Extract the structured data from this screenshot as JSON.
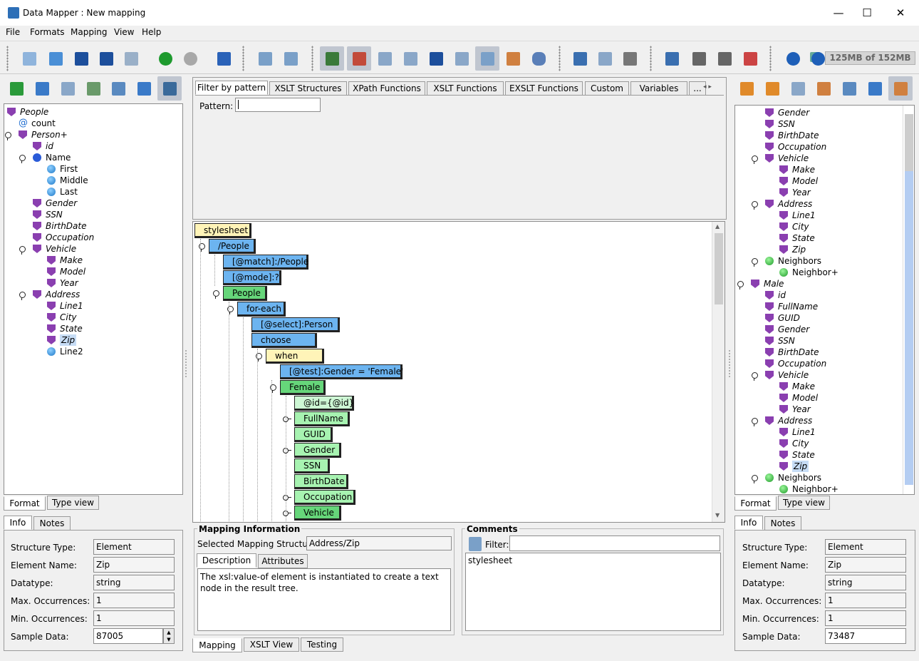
{
  "app": {
    "title": "Data Mapper : New mapping",
    "minimize": "—",
    "maximize": "☐",
    "close": "✕",
    "memory": "125MB of 152MB"
  },
  "menu": [
    "File",
    "Formats",
    "Mapping",
    "View",
    "Help"
  ],
  "colors": {
    "element": "#8a3fb0",
    "node_yellow": "#fff4b8",
    "node_blue": "#6cb4f0",
    "node_green": "#66d67a",
    "node_lightgreen": "#a7f3b1"
  },
  "left_tree": [
    {
      "label": "People",
      "icon": "element-icon",
      "italic": true
    },
    {
      "label": "count",
      "icon": "attribute-icon",
      "italic": false
    },
    {
      "label": "Person+",
      "icon": "element-icon",
      "italic": true
    },
    {
      "label": "id",
      "icon": "key-element-icon",
      "italic": true
    },
    {
      "label": "Name",
      "icon": "blue-circle-icon",
      "italic": false
    },
    {
      "label": "First",
      "icon": "light-blue-circle-icon",
      "italic": false
    },
    {
      "label": "Middle",
      "icon": "light-blue-circle-icon",
      "italic": false
    },
    {
      "label": "Last",
      "icon": "light-blue-circle-icon",
      "italic": false
    },
    {
      "label": "Gender",
      "icon": "element-icon",
      "italic": true
    },
    {
      "label": "SSN",
      "icon": "element-icon",
      "italic": true
    },
    {
      "label": "BirthDate",
      "icon": "element-icon",
      "italic": true
    },
    {
      "label": "Occupation",
      "icon": "element-icon",
      "italic": true
    },
    {
      "label": "Vehicle",
      "icon": "element-icon",
      "italic": true
    },
    {
      "label": "Make",
      "icon": "element-icon",
      "italic": true
    },
    {
      "label": "Model",
      "icon": "element-icon",
      "italic": true
    },
    {
      "label": "Year",
      "icon": "element-icon",
      "italic": true
    },
    {
      "label": "Address",
      "icon": "element-icon",
      "italic": true
    },
    {
      "label": "Line1",
      "icon": "element-icon",
      "italic": true
    },
    {
      "label": "City",
      "icon": "element-icon",
      "italic": true
    },
    {
      "label": "State",
      "icon": "element-icon",
      "italic": true
    },
    {
      "label": "Zip",
      "icon": "element-icon",
      "italic": true
    },
    {
      "label": "Line2",
      "icon": "light-blue-circle-icon",
      "italic": false
    }
  ],
  "right_tree": [
    {
      "label": "Gender",
      "icon": "element-icon",
      "italic": true
    },
    {
      "label": "SSN",
      "icon": "element-icon",
      "italic": true
    },
    {
      "label": "BirthDate",
      "icon": "element-icon",
      "italic": true
    },
    {
      "label": "Occupation",
      "icon": "element-icon",
      "italic": true
    },
    {
      "label": "Vehicle",
      "icon": "element-icon",
      "italic": true
    },
    {
      "label": "Make",
      "icon": "element-icon",
      "italic": true
    },
    {
      "label": "Model",
      "icon": "element-icon",
      "italic": true
    },
    {
      "label": "Year",
      "icon": "element-icon",
      "italic": true
    },
    {
      "label": "Address",
      "icon": "element-icon",
      "italic": true
    },
    {
      "label": "Line1",
      "icon": "element-icon",
      "italic": true
    },
    {
      "label": "City",
      "icon": "element-icon",
      "italic": true
    },
    {
      "label": "State",
      "icon": "element-icon",
      "italic": true
    },
    {
      "label": "Zip",
      "icon": "element-icon",
      "italic": true
    },
    {
      "label": "Neighbors",
      "icon": "green-circle-icon",
      "italic": false
    },
    {
      "label": "Neighbor+",
      "icon": "green-circle-icon",
      "italic": false
    },
    {
      "label": "Male",
      "icon": "element-icon",
      "italic": true
    },
    {
      "label": "id",
      "icon": "key-element-icon",
      "italic": true
    },
    {
      "label": "FullName",
      "icon": "element-icon",
      "italic": true
    },
    {
      "label": "GUID",
      "icon": "element-icon",
      "italic": true
    },
    {
      "label": "Gender",
      "icon": "element-icon",
      "italic": true
    },
    {
      "label": "SSN",
      "icon": "element-icon",
      "italic": true
    },
    {
      "label": "BirthDate",
      "icon": "element-icon",
      "italic": true
    },
    {
      "label": "Occupation",
      "icon": "element-icon",
      "italic": true
    },
    {
      "label": "Vehicle",
      "icon": "element-icon",
      "italic": true
    },
    {
      "label": "Make",
      "icon": "element-icon",
      "italic": true
    },
    {
      "label": "Model",
      "icon": "element-icon",
      "italic": true
    },
    {
      "label": "Year",
      "icon": "element-icon",
      "italic": true
    },
    {
      "label": "Address",
      "icon": "element-icon",
      "italic": true
    },
    {
      "label": "Line1",
      "icon": "element-icon",
      "italic": true
    },
    {
      "label": "City",
      "icon": "element-icon",
      "italic": true
    },
    {
      "label": "State",
      "icon": "element-icon",
      "italic": true
    },
    {
      "label": "Zip",
      "icon": "element-icon",
      "italic": true
    },
    {
      "label": "Neighbors",
      "icon": "green-circle-icon",
      "italic": false
    },
    {
      "label": "Neighbor+",
      "icon": "green-circle-icon",
      "italic": false
    }
  ],
  "left_tabs": {
    "format": "Format",
    "type_view": "Type view",
    "info": "Info",
    "notes": "Notes"
  },
  "info_labels": {
    "structure_type": "Structure Type:",
    "element_name": "Element Name:",
    "datatype": "Datatype:",
    "max": "Max. Occurrences:",
    "min": "Min. Occurrences:",
    "sample": "Sample Data:"
  },
  "left_info": {
    "structure_type": "Element",
    "element_name": "Zip",
    "datatype": "string",
    "max": "1",
    "min": "1",
    "sample": "87005"
  },
  "right_info": {
    "structure_type": "Element",
    "element_name": "Zip",
    "datatype": "string",
    "max": "1",
    "min": "1",
    "sample": "73487"
  },
  "func_tabs": [
    "Filter by pattern",
    "XSLT Structures",
    "XPath Functions",
    "XSLT Functions",
    "EXSLT Functions",
    "Custom",
    "Variables",
    "..."
  ],
  "pattern": {
    "label": "Pattern:",
    "value": ""
  },
  "mapping_nodes": [
    {
      "label": "stylesheet",
      "color": "y"
    },
    {
      "label": "/People",
      "color": "b"
    },
    {
      "label": "[@match]:/People",
      "color": "b"
    },
    {
      "label": "[@mode]:?",
      "color": "b"
    },
    {
      "label": "People",
      "color": "g"
    },
    {
      "label": "for-each",
      "color": "b"
    },
    {
      "label": "[@select]:Person",
      "color": "b"
    },
    {
      "label": "choose",
      "color": "b"
    },
    {
      "label": "when",
      "color": "y"
    },
    {
      "label": "[@test]:Gender = 'Female'",
      "color": "b"
    },
    {
      "label": "Female",
      "color": "g"
    },
    {
      "label": "@id={@id}",
      "color": "w"
    },
    {
      "label": "FullName",
      "color": "lg"
    },
    {
      "label": "GUID",
      "color": "lg"
    },
    {
      "label": "Gender",
      "color": "lg"
    },
    {
      "label": "SSN",
      "color": "lg"
    },
    {
      "label": "BirthDate",
      "color": "lg"
    },
    {
      "label": "Occupation",
      "color": "lg"
    },
    {
      "label": "Vehicle",
      "color": "g"
    }
  ],
  "mapping_info": {
    "title": "Mapping Information",
    "selected_label": "Selected Mapping Structure:",
    "selected_value": "Address/Zip",
    "tab_description": "Description",
    "tab_attributes": "Attributes",
    "description": "The xsl:value-of element is instantiated to create a text node in the result tree."
  },
  "comments": {
    "title": "Comments",
    "filter_label": "Filter:",
    "filter_value": "",
    "text": "stylesheet"
  },
  "bottom_tabs": {
    "mapping": "Mapping",
    "xslt_view": "XSLT View",
    "testing": "Testing"
  }
}
